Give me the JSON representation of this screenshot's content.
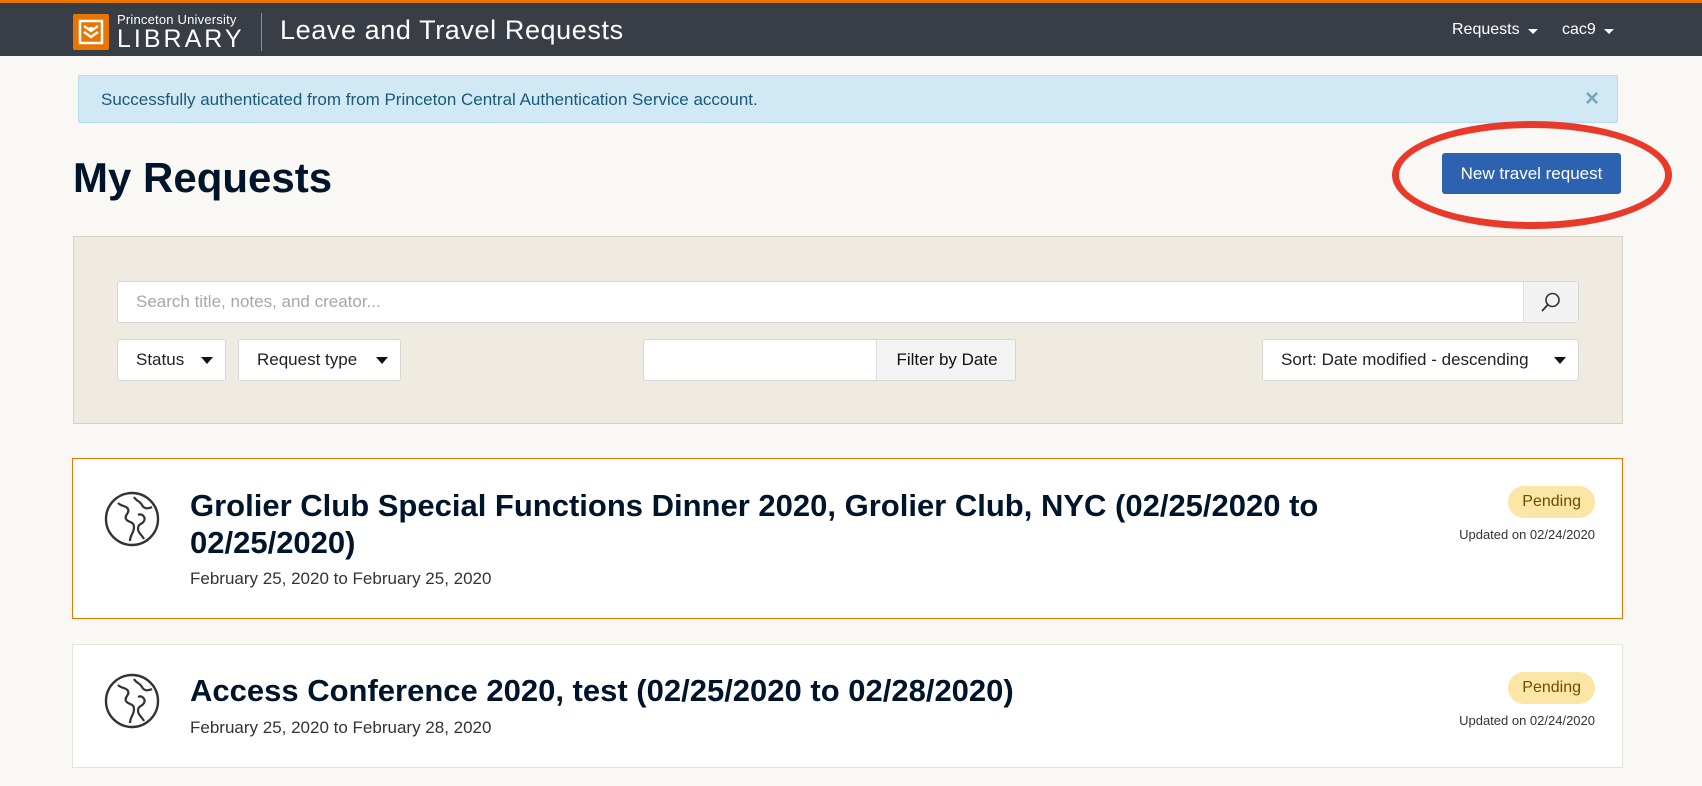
{
  "header": {
    "logo_small": "Princeton University",
    "logo_big": "LIBRARY",
    "app_title": "Leave and Travel Requests",
    "nav": [
      {
        "label": "Requests"
      },
      {
        "label": "cac9"
      }
    ]
  },
  "alert": {
    "message": "Successfully authenticated from from Princeton Central Authentication Service account.",
    "close": "×"
  },
  "page": {
    "title": "My Requests",
    "new_button": "New travel request"
  },
  "filters": {
    "search_placeholder": "Search title, notes, and creator...",
    "status_label": "Status",
    "request_type_label": "Request type",
    "date_button": "Filter by Date",
    "sort_label": "Sort: Date modified - descending"
  },
  "requests": [
    {
      "title": "Grolier Club Special Functions Dinner 2020, Grolier Club, NYC (02/25/2020 to 02/25/2020)",
      "dates": "February 25, 2020 to February 25, 2020",
      "status": "Pending",
      "updated": "Updated on 02/24/2020",
      "icon": "globe-icon"
    },
    {
      "title": "Access Conference 2020, test (02/25/2020 to 02/28/2020)",
      "dates": "February 25, 2020 to February 28, 2020",
      "status": "Pending",
      "updated": "Updated on 02/24/2020",
      "icon": "globe-icon"
    }
  ],
  "colors": {
    "header_bg": "#383d46",
    "accent_orange": "#e77500",
    "primary_button": "#2c62b0",
    "pending_badge": "#fbe6a5",
    "highlight_ring": "#e8392b"
  }
}
